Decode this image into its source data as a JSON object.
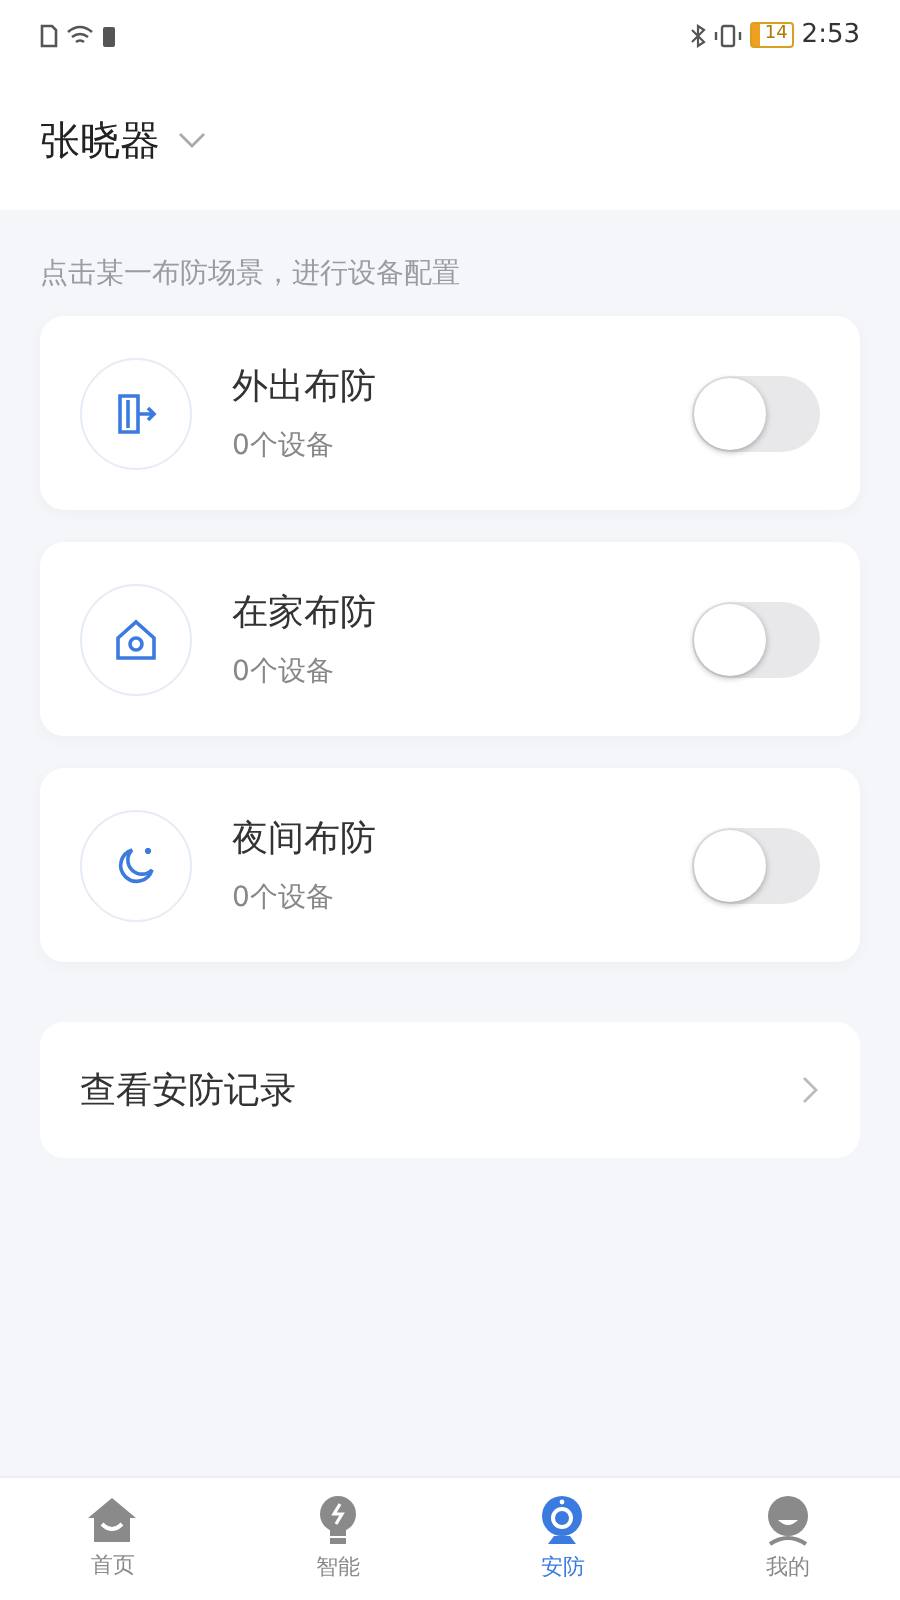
{
  "status_bar": {
    "battery": "14",
    "time": "2:53"
  },
  "header": {
    "title": "张晓器"
  },
  "hint": "点击某一布防场景，进行设备配置",
  "scenes": [
    {
      "kind": "away",
      "name": "外出布防",
      "devices": "0个设备",
      "on": false
    },
    {
      "kind": "home",
      "name": "在家布防",
      "devices": "0个设备",
      "on": false
    },
    {
      "kind": "night",
      "name": "夜间布防",
      "devices": "0个设备",
      "on": false
    }
  ],
  "record": {
    "label": "查看安防记录"
  },
  "tabs": [
    {
      "kind": "home",
      "label": "首页",
      "selected": false
    },
    {
      "kind": "smart",
      "label": "智能",
      "selected": false
    },
    {
      "kind": "security",
      "label": "安防",
      "selected": true
    },
    {
      "kind": "me",
      "label": "我的",
      "selected": false
    }
  ]
}
